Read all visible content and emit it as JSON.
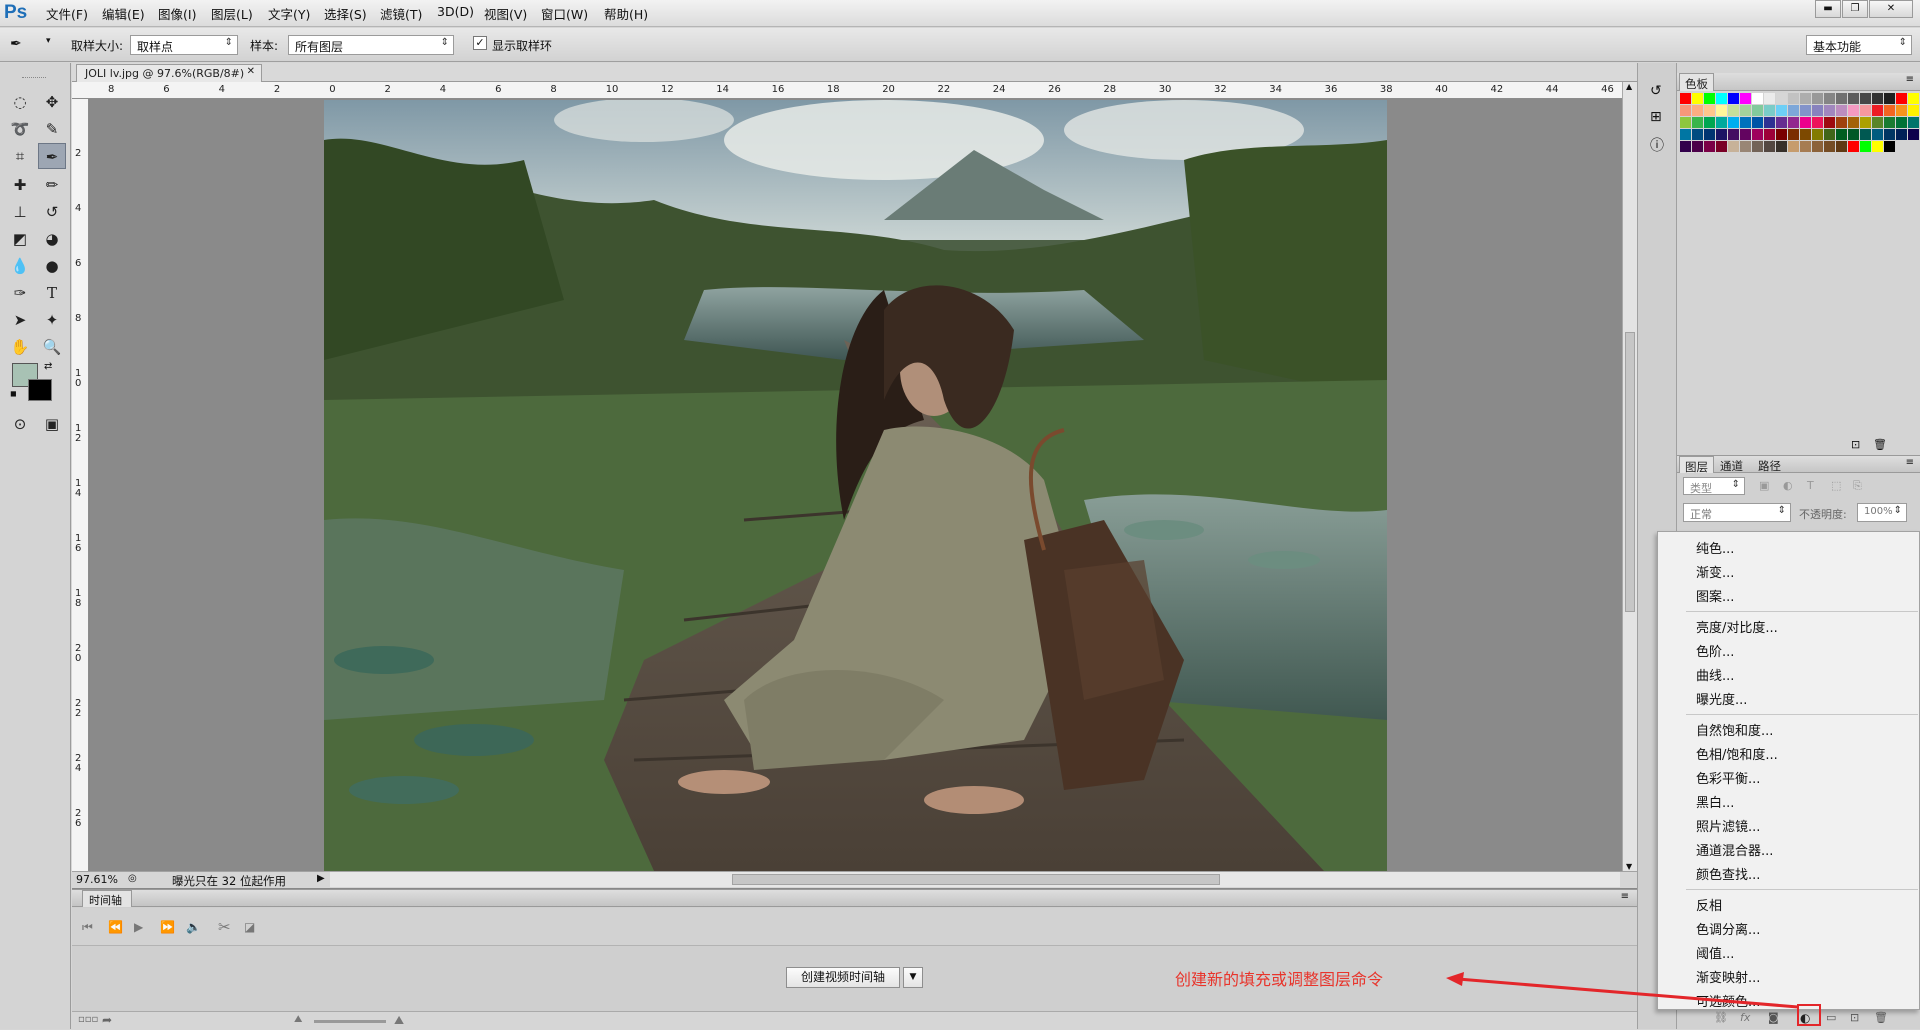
{
  "app": {
    "logo": "Ps"
  },
  "menubar": {
    "items": [
      "文件(F)",
      "编辑(E)",
      "图像(I)",
      "图层(L)",
      "文字(Y)",
      "选择(S)",
      "滤镜(T)",
      "3D(D)",
      "视图(V)",
      "窗口(W)",
      "帮助(H)"
    ]
  },
  "window_controls": {
    "minimize": "▬",
    "restore": "❐",
    "close": "✕"
  },
  "options": {
    "sample_size_label": "取样大小:",
    "sample_size_value": "取样点",
    "sample_label": "样本:",
    "sample_value": "所有图层",
    "show_ring_label": "显示取样环",
    "workspace": "基本功能"
  },
  "document": {
    "tab_title": "JOLI lv.jpg @ 97.6%(RGB/8#)",
    "close": "✕"
  },
  "ruler": {
    "h_ticks": [
      "8",
      "6",
      "4",
      "2",
      "0",
      "2",
      "4",
      "6",
      "8",
      "10",
      "12",
      "14",
      "16",
      "18",
      "20",
      "22",
      "24",
      "26",
      "28",
      "30",
      "32",
      "34",
      "36",
      "38",
      "40",
      "42",
      "44",
      "46"
    ],
    "v_ticks": [
      "2",
      "4",
      "6",
      "8",
      "1 0",
      "1 2",
      "1 4",
      "1 6",
      "1 8",
      "2 0",
      "2 2",
      "2 4",
      "2 6"
    ]
  },
  "status": {
    "zoom": "97.61%",
    "message": "曝光只在 32 位起作用"
  },
  "timeline": {
    "tab": "时间轴",
    "create_button": "创建视频时间轴"
  },
  "panels": {
    "swatches_tab": "色板",
    "layers_tabs": [
      "图层",
      "通道",
      "路径"
    ],
    "kind_label": "类型",
    "blend_mode": "正常",
    "opacity_label": "不透明度:",
    "opacity_value": "100%"
  },
  "adjust_menu": {
    "groups": [
      [
        "纯色...",
        "渐变...",
        "图案..."
      ],
      [
        "亮度/对比度...",
        "色阶...",
        "曲线...",
        "曝光度..."
      ],
      [
        "自然饱和度...",
        "色相/饱和度...",
        "色彩平衡...",
        "黑白...",
        "照片滤镜...",
        "通道混合器...",
        "颜色查找..."
      ],
      [
        "反相",
        "色调分离...",
        "阈值...",
        "渐变映射...",
        "可选颜色..."
      ]
    ]
  },
  "annotation": {
    "callout_text": "创建新的填充或调整图层命令",
    "color": "#e8352c"
  },
  "colors": {
    "foreground": "#a8c2b4",
    "background": "#000000",
    "accent_active_tool": "#9da6b3"
  },
  "swatch_rows": [
    [
      "#ff0000",
      "#ffff00",
      "#00ff00",
      "#00ffff",
      "#0000ff",
      "#ff00ff",
      "#ffffff",
      "#ebebeb",
      "#d6d6d6",
      "#c2c2c2",
      "#adadad",
      "#999999",
      "#858585",
      "#707070",
      "#5c5c5c",
      "#474747",
      "#333333",
      "#1f1f1f",
      "#ff0000",
      "#ffff00"
    ],
    [
      "#f7977a",
      "#fbad82",
      "#fdc68c",
      "#fff79a",
      "#c4df9b",
      "#a3d39c",
      "#82ca9c",
      "#7accc8",
      "#6dcff6",
      "#7da7d9",
      "#8393ca",
      "#8882be",
      "#a187be",
      "#bc8dbf",
      "#f49ac2",
      "#f6989d",
      "#ed1c24",
      "#f26522",
      "#f7941d",
      "#fff200"
    ],
    [
      "#8dc73f",
      "#39b54a",
      "#00a651",
      "#00a99d",
      "#00aeef",
      "#0072bc",
      "#0054a6",
      "#2e3192",
      "#662d91",
      "#92278f",
      "#ec008c",
      "#ed145b",
      "#9e0b0f",
      "#a0410d",
      "#a36209",
      "#aba000",
      "#598527",
      "#197b30",
      "#007236",
      "#00746b"
    ],
    [
      "#0076a3",
      "#004b80",
      "#003471",
      "#1b1464",
      "#440e62",
      "#630460",
      "#9e005d",
      "#9e0039",
      "#790000",
      "#7b2e00",
      "#7d4900",
      "#827b00",
      "#406618",
      "#005e20",
      "#005826",
      "#005952",
      "#005b7f",
      "#003663",
      "#002157",
      "#0d004c"
    ],
    [
      "#32004b",
      "#4b0049",
      "#7b0046",
      "#7a0026",
      "#c7b299",
      "#998675",
      "#736357",
      "#534741",
      "#37302a",
      "#c69c6d",
      "#a67c52",
      "#8c6239",
      "#754c24",
      "#603913",
      "#ff0000",
      "#00ff00",
      "#ffff00",
      "#000000",
      "#d4d4d4",
      "#d4d4d4"
    ]
  ]
}
